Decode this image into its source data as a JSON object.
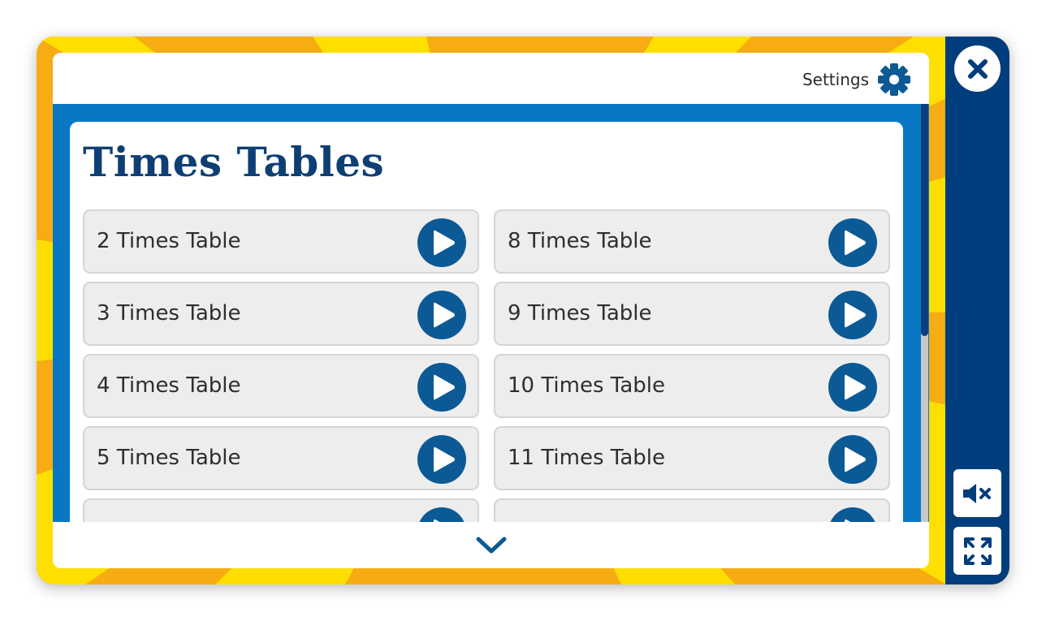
{
  "header": {
    "settings_label": "Settings",
    "settings_icon": "gear-icon"
  },
  "main": {
    "title": "Times Tables",
    "items": [
      {
        "label": "2 Times Table"
      },
      {
        "label": "8 Times Table"
      },
      {
        "label": "3 Times Table"
      },
      {
        "label": "9 Times Table"
      },
      {
        "label": "4 Times Table"
      },
      {
        "label": "10 Times Table"
      },
      {
        "label": "5 Times Table"
      },
      {
        "label": "11 Times Table"
      },
      {
        "label": ""
      },
      {
        "label": ""
      }
    ],
    "item_icon": "play-icon",
    "scroll_down_icon": "chevron-down-icon"
  },
  "side_panel": {
    "close_icon": "close-icon",
    "mute_icon": "mute-icon",
    "fullscreen_icon": "fullscreen-icon"
  },
  "colors": {
    "frame_orange": "#f6ac12",
    "frame_yellow": "#ffe100",
    "side_navy": "#003d7d",
    "content_blue": "#0878c5",
    "title_navy": "#0e3f74",
    "play_blue": "#0b5a96",
    "item_gray": "#ededed"
  }
}
